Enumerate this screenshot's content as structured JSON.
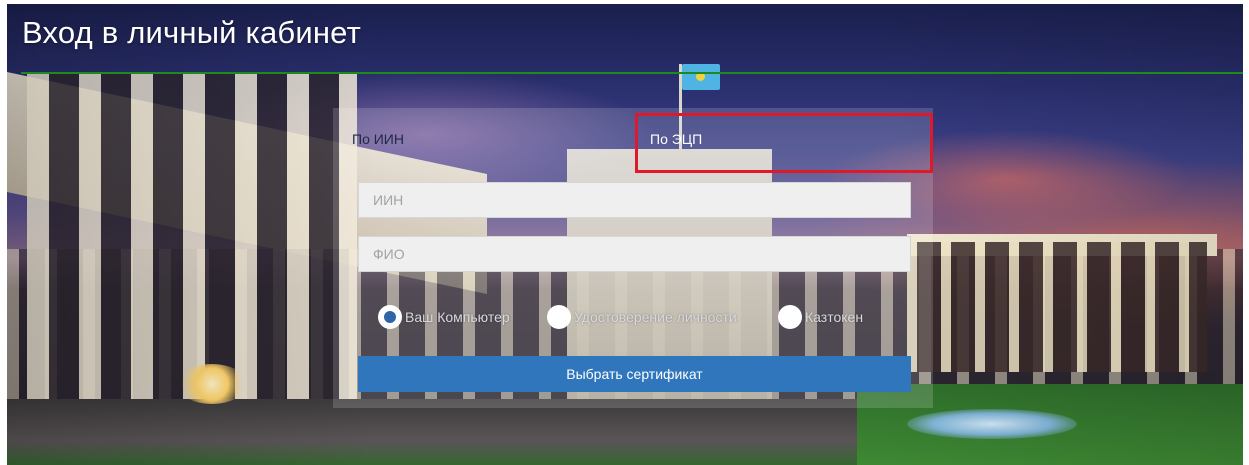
{
  "header": {
    "title": "Вход в личный кабинет"
  },
  "tabs": [
    {
      "label": "По ИИН",
      "active": false
    },
    {
      "label": "По ЭЦП",
      "active": true
    }
  ],
  "form": {
    "iin_field": {
      "placeholder": "ИИН",
      "value": ""
    },
    "fio_field": {
      "placeholder": "ФИО",
      "value": ""
    },
    "storage_options": [
      {
        "label": "Ваш Компьютер",
        "selected": true
      },
      {
        "label": "Удостоверение личности",
        "selected": false
      },
      {
        "label": "Казтокен",
        "selected": false
      }
    ],
    "submit_label": "Выбрать сертификат"
  },
  "colors": {
    "title_rule": "#1c8a1c",
    "primary_button": "#2f76bc",
    "radio_selected": "#2f64a8",
    "highlight": "#e0192a"
  }
}
